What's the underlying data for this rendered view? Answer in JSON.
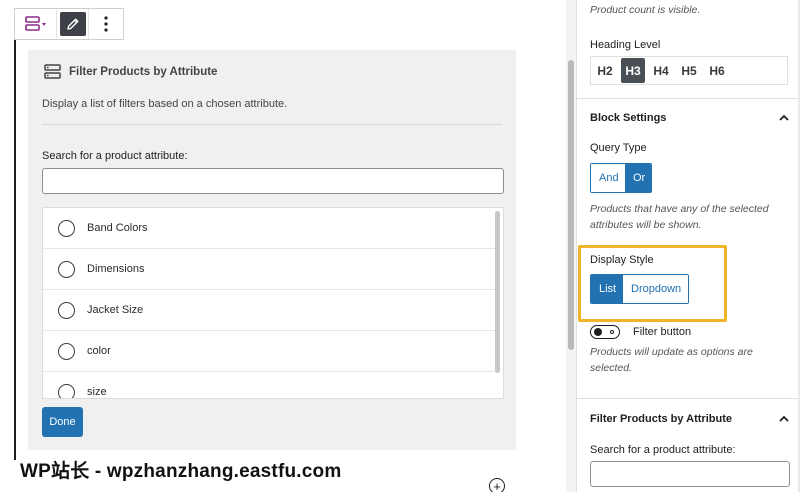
{
  "editor": {
    "block_title": "Filter Products by Attribute",
    "block_description": "Display a list of filters based on a chosen attribute.",
    "search_label": "Search for a product attribute:",
    "search_value": "",
    "attributes": [
      "Band Colors",
      "Dimensions",
      "Jacket Size",
      "color",
      "size"
    ],
    "done_label": "Done",
    "add_block_symbol": "+"
  },
  "watermark": "WP站长 - wpzhanzhang.eastfu.com",
  "sidebar": {
    "product_count_note": "Product count is visible.",
    "heading_level": {
      "label": "Heading Level",
      "options": [
        "H2",
        "H3",
        "H4",
        "H5",
        "H6"
      ],
      "selected": "H3"
    },
    "block_settings": {
      "title": "Block Settings",
      "query_type": {
        "label": "Query Type",
        "options": [
          "And",
          "Or"
        ],
        "selected": "Or",
        "help": "Products that have any of the selected attributes will be shown."
      },
      "display_style": {
        "label": "Display Style",
        "options": [
          "List",
          "Dropdown"
        ],
        "selected": "List"
      },
      "filter_button": {
        "label": "Filter button",
        "enabled": false,
        "help": "Products will update as options are selected."
      }
    },
    "filter_section": {
      "title": "Filter Products by Attribute",
      "search_label": "Search for a product attribute:",
      "search_value": ""
    }
  },
  "colors": {
    "accent": "#2271b1",
    "highlight": "#f0b429",
    "dark_active": "#4a4f55",
    "panel_bg": "#f0f0f0"
  },
  "icons": {
    "block_switcher": "filter-block-icon",
    "edit": "pencil-icon",
    "more": "vertical-ellipsis-icon",
    "collapse": "chevron-up-icon",
    "add": "plus-circle-icon"
  }
}
